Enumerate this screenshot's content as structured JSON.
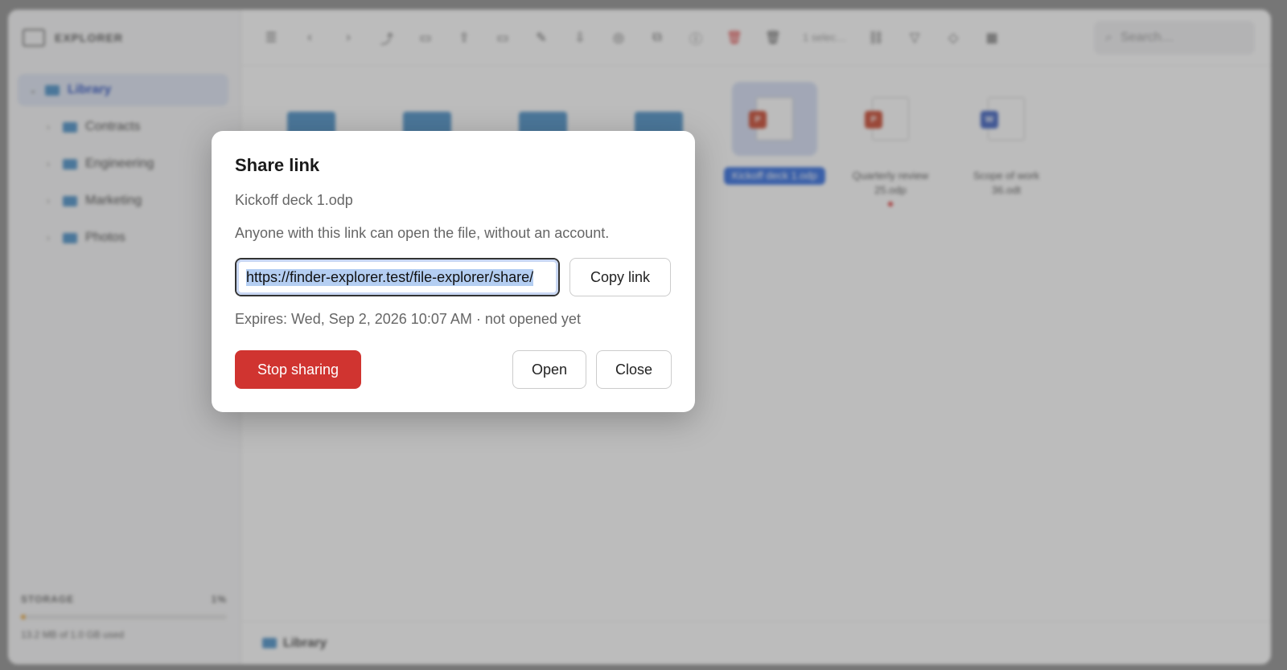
{
  "app": {
    "brand": "EXPLORER",
    "tree": [
      {
        "label": "Library",
        "root": true
      },
      {
        "label": "Contracts"
      },
      {
        "label": "Engineering"
      },
      {
        "label": "Marketing"
      },
      {
        "label": "Photos"
      }
    ],
    "storage": {
      "label": "STORAGE",
      "percent_label": "1%",
      "used": "13.2 MB of 1.0 GB used",
      "fraction": 0.01
    },
    "toolbar": {
      "selection": "1 selec…",
      "search_placeholder": "Search…"
    },
    "files": [
      {
        "name": "",
        "kind": "folder"
      },
      {
        "name": "",
        "kind": "folder"
      },
      {
        "name": "",
        "kind": "folder"
      },
      {
        "name": "",
        "kind": "folder"
      },
      {
        "name": "Kickoff deck 1.odp",
        "kind": "odp",
        "badge": "P",
        "selected": true
      },
      {
        "name": "Quarterly review 25.odp",
        "kind": "odp",
        "badge": "P",
        "modified": true
      },
      {
        "name": "Scope of work 36.odt",
        "kind": "odt",
        "badge": "W"
      }
    ],
    "status_path": "Library"
  },
  "colors": {
    "danger": "#d03430",
    "accent": "#2f6be0",
    "folder": "#4a90c8",
    "odp": "#c9452c",
    "odt": "#3b5fc0"
  },
  "dialog": {
    "title": "Share link",
    "file_name": "Kickoff deck 1.odp",
    "description": "Anyone with this link can open the file, without an account.",
    "link_value": "https://finder-explorer.test/file-explorer/share/",
    "copy_label": "Copy link",
    "expires": "Expires: Wed, Sep 2, 2026 10:07 AM · not opened yet",
    "stop_label": "Stop sharing",
    "open_label": "Open",
    "close_label": "Close"
  }
}
